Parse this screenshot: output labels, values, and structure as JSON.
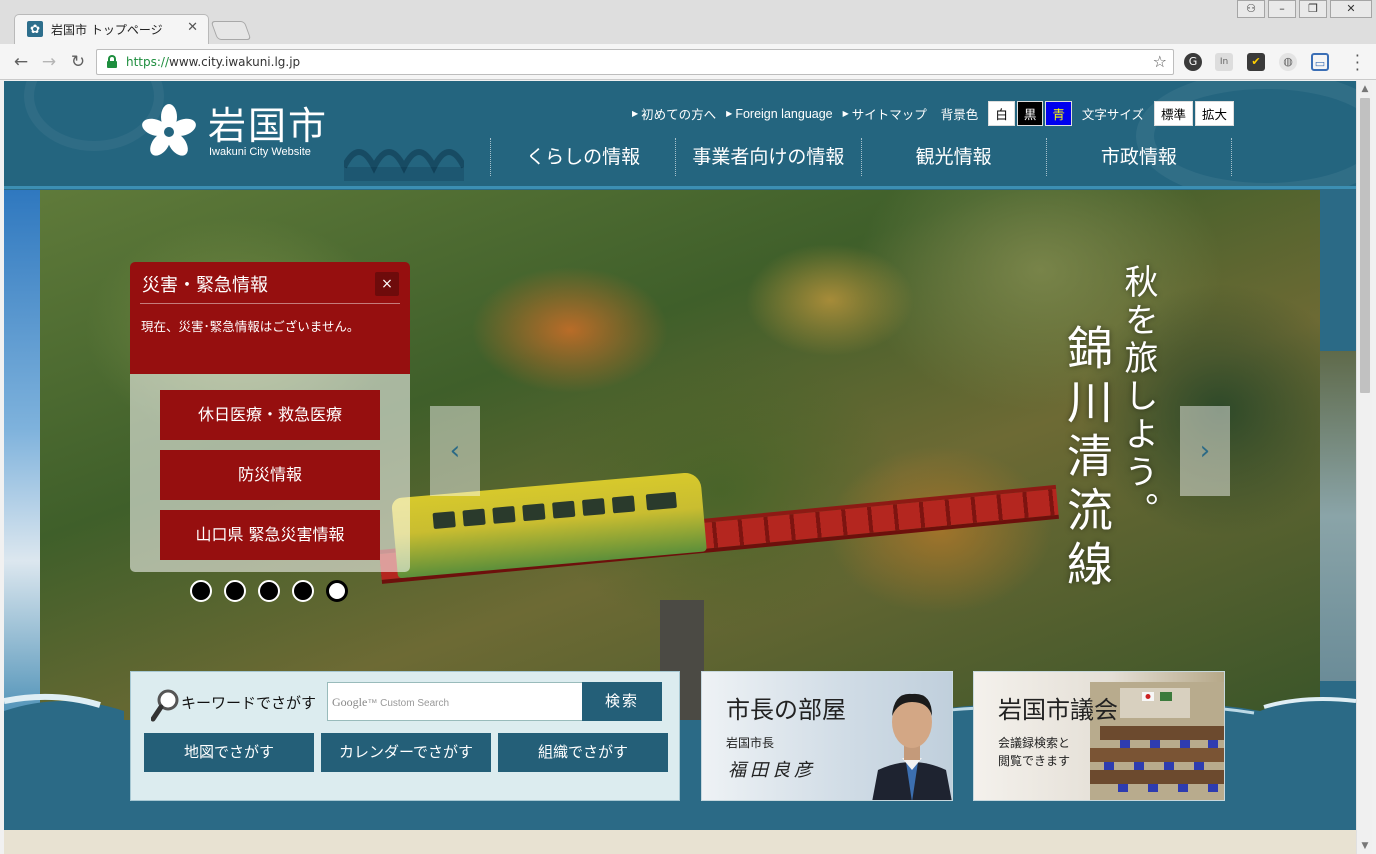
{
  "browser": {
    "tab_title": "岩国市 トップページ",
    "url_scheme": "https://",
    "url_host": "www.city.iwakuni.lg.jp",
    "window_buttons": [
      "user-icon",
      "minimize-icon",
      "restore-icon",
      "close-icon"
    ],
    "extension_icons": [
      "grammarly-icon",
      "in-icon",
      "checklist-icon",
      "ghostery-icon",
      "screenshot-icon"
    ]
  },
  "header": {
    "logo_title": "岩国市",
    "logo_subtitle": "Iwakuni City Website",
    "util_links": [
      "初めての方へ",
      "Foreign language",
      "サイトマップ"
    ],
    "bg_color_label": "背景色",
    "bg_colors": [
      "白",
      "黒",
      "青"
    ],
    "font_size_label": "文字サイズ",
    "font_sizes": [
      "標準",
      "拡大"
    ],
    "main_nav": [
      "くらしの情報",
      "事業者向けの情報",
      "観光情報",
      "市政情報"
    ]
  },
  "hero": {
    "vertical_text_1": "秋を旅しよう。",
    "vertical_text_2": "錦川清流線",
    "prev_arrow": "‹",
    "next_arrow": "›",
    "slides_total": 5,
    "active_slide": 5
  },
  "emergency": {
    "title": "災害・緊急情報",
    "close": "×",
    "message": "現在、災害･緊急情報はございません。",
    "buttons": [
      "休日医療・救急医療",
      "防災情報",
      "山口県 緊急災害情報"
    ]
  },
  "search": {
    "label": "キーワードでさがす",
    "placeholder_brand": "Google",
    "placeholder_text": "Custom Search",
    "submit": "検索",
    "quick_buttons": [
      "地図でさがす",
      "カレンダーでさがす",
      "組織でさがす"
    ]
  },
  "cards": {
    "mayor": {
      "title": "市長の部屋",
      "role": "岩国市長",
      "signature": "福田良彦"
    },
    "council": {
      "title": "岩国市議会",
      "line1": "会議録検索と",
      "line2": "閲覧できます"
    }
  },
  "colors": {
    "header_bg": "#24657f",
    "emergency_red": "#960f0f",
    "button_teal": "#245f78"
  }
}
